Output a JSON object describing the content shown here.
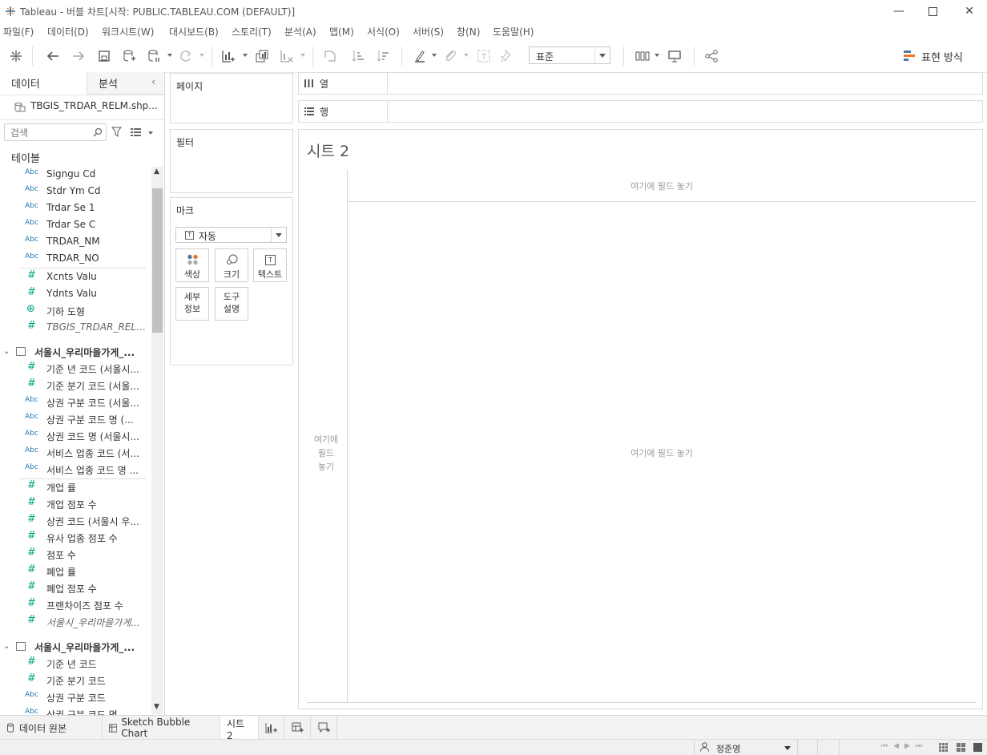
{
  "window": {
    "title": "Tableau - 버블 차트[시작: PUBLIC.TABLEAU.COM (DEFAULT)]"
  },
  "menu": [
    "파일(F)",
    "데이터(D)",
    "워크시트(W)",
    "대시보드(B)",
    "스토리(T)",
    "분석(A)",
    "맵(M)",
    "서식(O)",
    "서버(S)",
    "창(N)",
    "도움말(H)"
  ],
  "toolbar": {
    "fit_value": "표준",
    "show_me": "표현 방식"
  },
  "data_pane": {
    "tab_data": "데이터",
    "tab_analysis": "분석",
    "datasource": "TBGIS_TRDAR_RELM.shp...",
    "search_placeholder": "검색",
    "tables_heading": "테이블",
    "fields1": [
      {
        "type": "Abc",
        "name": "Signgu Cd"
      },
      {
        "type": "Abc",
        "name": "Stdr Ym Cd"
      },
      {
        "type": "Abc",
        "name": "Trdar Se 1"
      },
      {
        "type": "Abc",
        "name": "Trdar Se C"
      },
      {
        "type": "Abc",
        "name": "TRDAR_NM"
      },
      {
        "type": "Abc",
        "name": "TRDAR_NO"
      }
    ],
    "measures1": [
      {
        "type": "#",
        "name": "Xcnts Valu"
      },
      {
        "type": "#",
        "name": "Ydnts Valu"
      },
      {
        "type": "geo",
        "name": "기하 도형"
      },
      {
        "type": "#",
        "name": "TBGIS_TRDAR_RELM...",
        "italic": true
      }
    ],
    "table2": "서울시_우리마을가게_...",
    "fields2a": [
      {
        "type": "#",
        "name": "기준 년 코드 (서울시..."
      },
      {
        "type": "#",
        "name": "기준 분기 코드 (서울..."
      },
      {
        "type": "Abc",
        "name": "상권 구분 코드 (서울..."
      },
      {
        "type": "Abc",
        "name": "상권 구분 코드 명 (..."
      },
      {
        "type": "Abc",
        "name": "상권 코드 명 (서울시..."
      },
      {
        "type": "Abc",
        "name": "서비스 업종 코드 (서..."
      },
      {
        "type": "Abc",
        "name": "서비스 업종 코드 명 ..."
      }
    ],
    "fields2b": [
      {
        "type": "#",
        "name": "개업 률"
      },
      {
        "type": "#",
        "name": "개업 점포 수"
      },
      {
        "type": "#",
        "name": "상권 코드 (서울시 우..."
      },
      {
        "type": "#",
        "name": "유사 업종 점포 수"
      },
      {
        "type": "#",
        "name": "점포 수"
      },
      {
        "type": "#",
        "name": "폐업 률"
      },
      {
        "type": "#",
        "name": "폐업 점포 수"
      },
      {
        "type": "#",
        "name": "프랜차이즈 점포 수"
      },
      {
        "type": "#",
        "name": "서울시_우리마을가게...",
        "italic": true
      }
    ],
    "table3": "서울시_우리마을가게_...",
    "fields3": [
      {
        "type": "#",
        "name": "기준 년 코드"
      },
      {
        "type": "#",
        "name": "기준 분기 코드"
      },
      {
        "type": "Abc",
        "name": "상권 구분 코드"
      },
      {
        "type": "Abc",
        "name": "상권 구분 코드 명"
      }
    ]
  },
  "cards": {
    "pages": "페이지",
    "filters": "필터",
    "marks": "마크",
    "marks_type": "자동",
    "color": "색상",
    "size": "크기",
    "text": "텍스트",
    "detail_1": "세부",
    "detail_2": "정보",
    "tooltip_1": "도구",
    "tooltip_2": "설명"
  },
  "shelves": {
    "columns": "열",
    "rows": "행"
  },
  "view": {
    "sheet_title": "시트 2",
    "drop_top": "여기에 필드 놓기",
    "drop_center": "여기에 필드 놓기",
    "drop_left_1": "여기에",
    "drop_left_2": "필드",
    "drop_left_3": "놓기"
  },
  "bottom_tabs": {
    "data_source": "데이터 원본",
    "sheet1": "Sketch Bubble Chart",
    "sheet2": "시트 2"
  },
  "status": {
    "user": "정준영"
  }
}
